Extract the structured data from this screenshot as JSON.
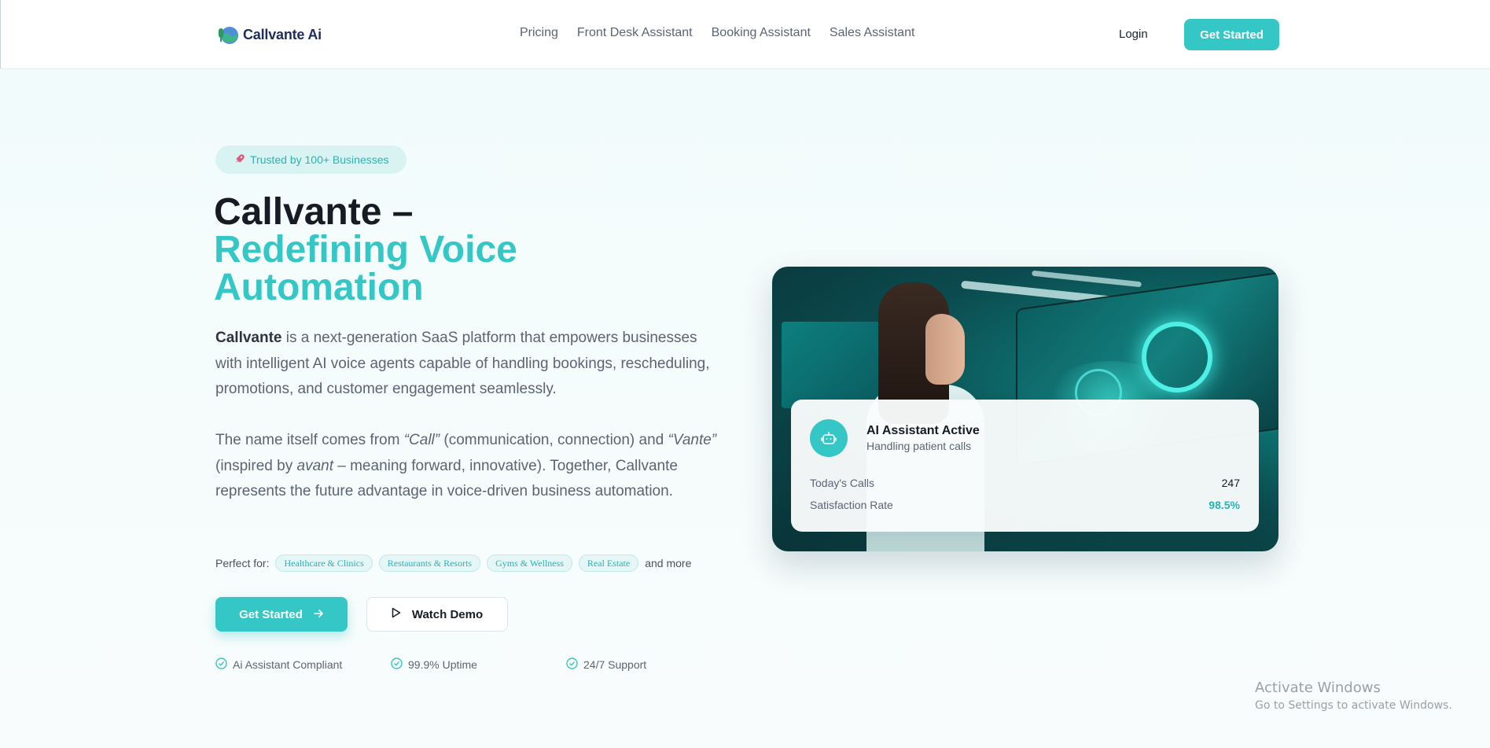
{
  "header": {
    "brand": "Callvante Ai",
    "nav": [
      "Pricing",
      "Front Desk Assistant",
      "Booking Assistant",
      "Sales Assistant"
    ],
    "login": "Login",
    "get_started": "Get Started"
  },
  "hero": {
    "badge": "Trusted by 100+ Businesses",
    "title_line1": "Callvante –",
    "title_line2": "Redefining Voice",
    "title_line3": "Automation",
    "para1_brand": "Callvante",
    "para1_rest": " is a next-generation SaaS platform that empowers businesses with intelligent AI voice agents capable of handling bookings, rescheduling, promotions, and customer engagement seamlessly.",
    "para2_a": "The name itself comes from ",
    "para2_call": "“Call”",
    "para2_b": " (communication, connection) and ",
    "para2_vante": "“Vante”",
    "para2_c": " (inspired by ",
    "para2_avant": "avant",
    "para2_d": " – meaning forward, innovative). Together, Callvante represents the future advantage in voice-driven business automation.",
    "perfect_for_label": "Perfect for:",
    "chips": [
      "Healthcare & Clinics",
      "Restaurants & Resorts",
      "Gyms & Wellness",
      "Real Estate"
    ],
    "and_more": "and more",
    "cta": "Get Started",
    "demo": "Watch Demo",
    "features": [
      "Ai Assistant Compliant",
      "99.9% Uptime",
      "24/7 Support"
    ]
  },
  "status_card": {
    "title": "AI Assistant Active",
    "subtitle": "Handling patient calls",
    "rows": [
      {
        "label": "Today's Calls",
        "value": "247"
      },
      {
        "label": "Satisfaction Rate",
        "value": "98.5%"
      }
    ]
  },
  "watermark": {
    "line1": "Activate Windows",
    "line2": "Go to Settings to activate Windows."
  },
  "colors": {
    "accent": "#35c6c6",
    "heading": "#161b24",
    "body": "#5b6474"
  }
}
